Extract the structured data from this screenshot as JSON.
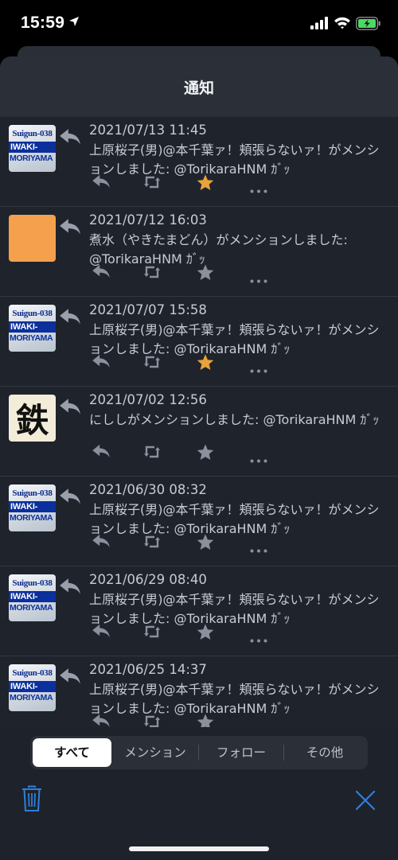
{
  "status": {
    "time": "15:59"
  },
  "sheet": {
    "title": "通知"
  },
  "notifications": [
    {
      "time": "2021/07/13 11:45",
      "text": "上原桜子(男)@本千葉ァ！頬張らないァ！がメンションしました: @TorikaraHNM ｶﾞｯ",
      "avatar": "suigun",
      "favorited": true
    },
    {
      "time": "2021/07/12 16:03",
      "text": "煮水（やきたまどん）がメンションしました: @TorikaraHNM ｶﾞｯ",
      "avatar": "orange",
      "favorited": false
    },
    {
      "time": "2021/07/07 15:58",
      "text": "上原桜子(男)@本千葉ァ！頬張らないァ！がメンションしました: @TorikaraHNM ｶﾞｯ",
      "avatar": "suigun",
      "favorited": true
    },
    {
      "time": "2021/07/02 12:56",
      "text": "にししがメンションしました: @TorikaraHNM ｶﾞｯ",
      "avatar": "kanji",
      "favorited": false
    },
    {
      "time": "2021/06/30 08:32",
      "text": "上原桜子(男)@本千葉ァ！頬張らないァ！がメンションしました: @TorikaraHNM ｶﾞｯ",
      "avatar": "suigun",
      "favorited": false
    },
    {
      "time": "2021/06/29 08:40",
      "text": "上原桜子(男)@本千葉ァ！頬張らないァ！がメンションしました: @TorikaraHNM ｶﾞｯ",
      "avatar": "suigun",
      "favorited": false
    },
    {
      "time": "2021/06/25 14:37",
      "text": "上原桜子(男)@本千葉ァ！頬張らないァ！がメンションしました: @TorikaraHNM ｶﾞｯ",
      "avatar": "suigun",
      "favorited": false
    }
  ],
  "avatar_text": {
    "suigun_top": "Suigun-038",
    "suigun_mid": "IWAKI-",
    "suigun_bot": "MORIYAMA",
    "kanji": "鉄"
  },
  "tabs": [
    "すべて",
    "メンション",
    "フォロー",
    "その他"
  ],
  "active_tab": "すべて",
  "colors": {
    "fav_active": "#e8a33a",
    "icon_inactive": "#8a909c",
    "accent_blue": "#2f7fd8",
    "background": "#1f232c"
  },
  "icons": {
    "reply": "reply-icon",
    "retweet": "retweet-icon",
    "favorite": "star-icon",
    "more": "more-icon",
    "trash": "trash-icon",
    "close": "close-icon"
  }
}
